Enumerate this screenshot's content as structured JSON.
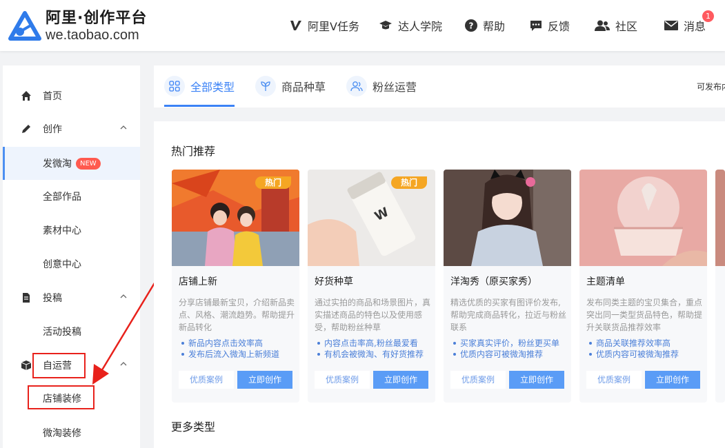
{
  "header": {
    "logo_title": "阿里·创作平台",
    "logo_url": "we.taobao.com",
    "nav": [
      {
        "label": "阿里V任务",
        "icon": "v-icon"
      },
      {
        "label": "达人学院",
        "icon": "graduation-cap-icon"
      },
      {
        "label": "帮助",
        "icon": "help-icon"
      },
      {
        "label": "反馈",
        "icon": "chat-bubble-icon"
      },
      {
        "label": "社区",
        "icon": "users-icon"
      },
      {
        "label": "消息",
        "icon": "envelope-icon"
      }
    ],
    "message_count": "1"
  },
  "sidebar": {
    "items": [
      {
        "label": "首页",
        "icon": "home-icon"
      },
      {
        "label": "创作",
        "icon": "pencil-icon"
      },
      {
        "label": "发微淘",
        "badge": "NEW"
      },
      {
        "label": "全部作品"
      },
      {
        "label": "素材中心"
      },
      {
        "label": "创意中心"
      },
      {
        "label": "投稿",
        "icon": "document-icon"
      },
      {
        "label": "活动投稿"
      },
      {
        "label": "自运营",
        "icon": "box-icon"
      },
      {
        "label": "店铺装修"
      },
      {
        "label": "微淘装修"
      }
    ]
  },
  "tabs": [
    {
      "label": "全部类型",
      "icon": "grid-icon"
    },
    {
      "label": "商品种草",
      "icon": "sprout-icon"
    },
    {
      "label": "粉丝运营",
      "icon": "fans-icon"
    }
  ],
  "tabs_right_text": "可发布内",
  "main": {
    "section_hot": "热门推荐",
    "section_more": "更多类型",
    "cards": [
      {
        "title": "店铺上新",
        "hot": "热门",
        "desc": "分享店铺最新宝贝，介绍新品卖点、风格、潮流趋势。帮助提升新品转化",
        "points": [
          "新品内容点击效率高",
          "发布后流入微淘上新频道"
        ],
        "case_label": "优质案例",
        "create_label": "立即创作"
      },
      {
        "title": "好货种草",
        "hot": "热门",
        "desc": "通过实拍的商品和场景图片，真实描述商品的特色以及使用感受，帮助粉丝种草",
        "points": [
          "内容点击率高,粉丝最爱看",
          "有机会被微淘、有好货推荐"
        ],
        "case_label": "优质案例",
        "create_label": "立即创作"
      },
      {
        "title": "洋淘秀（原买家秀）",
        "desc": "精选优质的买家有图评价发布,帮助完成商品转化，拉近与粉丝联系",
        "points": [
          "买家真实评价，粉丝更买单",
          "优质内容可被微淘推荐"
        ],
        "case_label": "优质案例",
        "create_label": "立即创作"
      },
      {
        "title": "主题清单",
        "desc": "发布同类主题的宝贝集合，重点突出同一类型货品特色，帮助提升关联货品推荐效率",
        "points": [
          "商品关联推荐效率高",
          "优质内容可被微淘推荐"
        ],
        "case_label": "优质案例",
        "create_label": "立即创作"
      }
    ]
  },
  "colors": {
    "accent": "#3b82f6",
    "annotation_red": "#e8211b",
    "hot_badge": "#f5a623",
    "new_badge": "#ff5a4f"
  }
}
